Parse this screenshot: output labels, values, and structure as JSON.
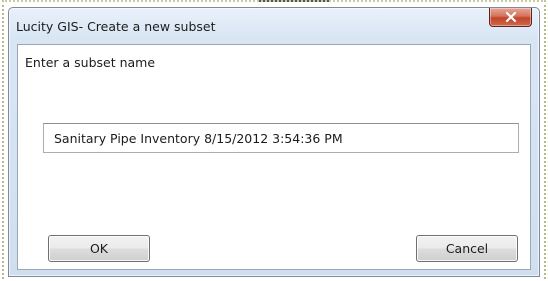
{
  "window": {
    "title": "Lucity GIS- Create a new subset",
    "close_icon": "close-x-icon"
  },
  "form": {
    "prompt": "Enter a subset name",
    "subset_name_value": "Sanitary Pipe Inventory 8/15/2012 3:54:36 PM"
  },
  "buttons": {
    "ok_label": "OK",
    "cancel_label": "Cancel"
  },
  "colors": {
    "close_button": "#c9573c",
    "dialog_frame": "#d8e6f4"
  }
}
